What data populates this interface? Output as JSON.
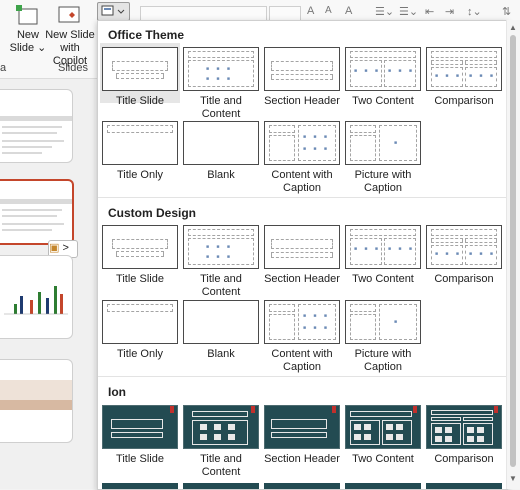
{
  "ribbon": {
    "new_slide": [
      "New",
      "Slide ⌄"
    ],
    "new_slide_copilot": [
      "New Slide",
      "with Copilot"
    ],
    "group_slides": "Slides",
    "group_left": "a"
  },
  "toolbar": {
    "font_size_up": "A",
    "font_size_down": "A",
    "clear_format": "A"
  },
  "thumbnails": {
    "paste_icon": "clipboard-icon",
    "paste_chevron": ">"
  },
  "gallery": {
    "sections": [
      {
        "title": "Office Theme",
        "layouts": [
          "Title Slide",
          "Title and Content",
          "Section Header",
          "Two Content",
          "Comparison",
          "Title Only",
          "Blank",
          "Content with Caption",
          "Picture with Caption"
        ]
      },
      {
        "title": "Custom Design",
        "layouts": [
          "Title Slide",
          "Title and Content",
          "Section Header",
          "Two Content",
          "Comparison",
          "Title Only",
          "Blank",
          "Content with Caption",
          "Picture with Caption"
        ]
      },
      {
        "title": "Ion",
        "layouts": [
          "Title Slide",
          "Title and Content",
          "Section Header",
          "Two Content",
          "Comparison"
        ]
      }
    ],
    "selected": "Title Slide"
  },
  "colors": {
    "accent_selection": "#c4462b",
    "ion_background": "#234b52",
    "ion_marker": "#c0302c"
  }
}
